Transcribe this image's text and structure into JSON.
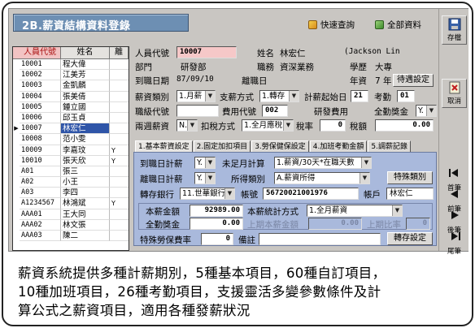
{
  "window": {
    "title": "2B.薪資結構資料登錄"
  },
  "toolbar": {
    "quick_search": "快速查詢",
    "all_data": "全部資料"
  },
  "side": {
    "save": "存檔",
    "cancel": "取消",
    "first": "首筆",
    "prev": "前筆",
    "next": "後筆",
    "last": "尾筆"
  },
  "list": {
    "col_id": "人員代號",
    "col_name": "姓名",
    "col_extra": "離",
    "rows": [
      {
        "id": "10001",
        "name": "程大偉",
        "extra": ""
      },
      {
        "id": "10002",
        "name": "江美芳",
        "extra": ""
      },
      {
        "id": "10003",
        "name": "金凱麟",
        "extra": ""
      },
      {
        "id": "10004",
        "name": "張美倩",
        "extra": ""
      },
      {
        "id": "10005",
        "name": "鍾立國",
        "extra": ""
      },
      {
        "id": "10006",
        "name": "邱玉貞",
        "extra": ""
      },
      {
        "id": "10007",
        "name": "林宏仁",
        "extra": ""
      },
      {
        "id": "10008",
        "name": "范小雯",
        "extra": ""
      },
      {
        "id": "10009",
        "name": "李嘉玟",
        "extra": "Y"
      },
      {
        "id": "10010",
        "name": "張天欣",
        "extra": "Y"
      },
      {
        "id": "A01",
        "name": "張三",
        "extra": ""
      },
      {
        "id": "A02",
        "name": "小王",
        "extra": ""
      },
      {
        "id": "A03",
        "name": "李四",
        "extra": ""
      },
      {
        "id": "A1234567",
        "name": "林鴻斌",
        "extra": "Y"
      },
      {
        "id": "AAA01",
        "name": "王大同",
        "extra": ""
      },
      {
        "id": "AAA02",
        "name": "林文張",
        "extra": ""
      },
      {
        "id": "AAA03",
        "name": "陳二",
        "extra": ""
      }
    ]
  },
  "form": {
    "emp_id_label": "人員代號",
    "emp_id": "10007",
    "name_label": "姓名",
    "name": "林宏仁",
    "eng_name": "(Jackson Lin",
    "dept_label": "部門",
    "dept": "研發部",
    "title_label": "職務",
    "title": "資深業務",
    "edu_label": "學歷",
    "edu": "大專",
    "hire_label": "到職日期",
    "hire": "87/09/10",
    "leave_label": "離職日",
    "years_label": "年資",
    "years": "7 年",
    "pending_btn": "待遇設定",
    "pay_cat_label": "薪資類別",
    "pay_cat": "1.月薪",
    "pay_method_label": "支薪方式",
    "pay_method": "1.轉存",
    "calc_start_label": "計薪起始日",
    "calc_start": "21",
    "attend_label": "考勤",
    "attend": "01",
    "grade_label": "職級代號",
    "fee_code_label": "費用代號",
    "fee_code": "002",
    "rd_fee_label": "研發費用",
    "bonus_label": "全勤獎金",
    "bonus": "Y.",
    "two_week_label": "兩週薪資",
    "two_week": "N.",
    "tax_method_label": "扣稅方式",
    "tax_method": "1.全月應稅",
    "tax_rate_label": "稅率",
    "tax_rate": "0",
    "tax_amt_label": "稅額",
    "tax_amt": "0.00"
  },
  "tabs": [
    "1.基本薪資設定",
    "2.固定加扣項目",
    "3.勞保健保設定",
    "4.加班考勤金額",
    "5.調薪記錄"
  ],
  "panel": {
    "hire_calc_label": "到職日計薪",
    "hire_calc": "Y.",
    "partial_label": "未足月計算",
    "partial": "1.薪資/30天*在職天數",
    "leave_calc_label": "離職日計薪",
    "leave_calc": "Y.",
    "income_type_label": "所得類別",
    "income_type": "A.薪資所得",
    "special_type_btn": "特殊類別",
    "bank_label": "轉存銀行",
    "bank": "11.世華銀行",
    "account_label": "帳號",
    "account": "56720021001976",
    "holder_label": "帳戶",
    "holder": "林宏仁",
    "base_label": "本薪金額",
    "base": "92989.00",
    "base_method_label": "本薪統計方式",
    "base_method": "1.全月薪資",
    "bonus_label": "全勤獎金",
    "bonus_amt": "0.00",
    "prev_amt_label": "上期本薪金額",
    "prev_amt": "0.00",
    "prev_ratio_label": "上期比率",
    "prev_ratio": "0",
    "special_ins_label": "特殊勞保費率",
    "special_ins": "0",
    "note_label": "備註",
    "transfer_btn": "轉存設定"
  },
  "caption": {
    "line1": "薪資系統提供多種計薪期別，5種基本項目，60種自訂項目，",
    "line2": "10種加班項目，26種考勤項目，支援靈活多變參數條件及計",
    "line3": "算公式之薪資項目，適用各種發薪狀況"
  },
  "colors": {
    "title_bg": "#6d8fb3",
    "panel_bg": "#a9b9dc",
    "selected": "#2f55a8",
    "key_field": "#f6c8c8"
  }
}
